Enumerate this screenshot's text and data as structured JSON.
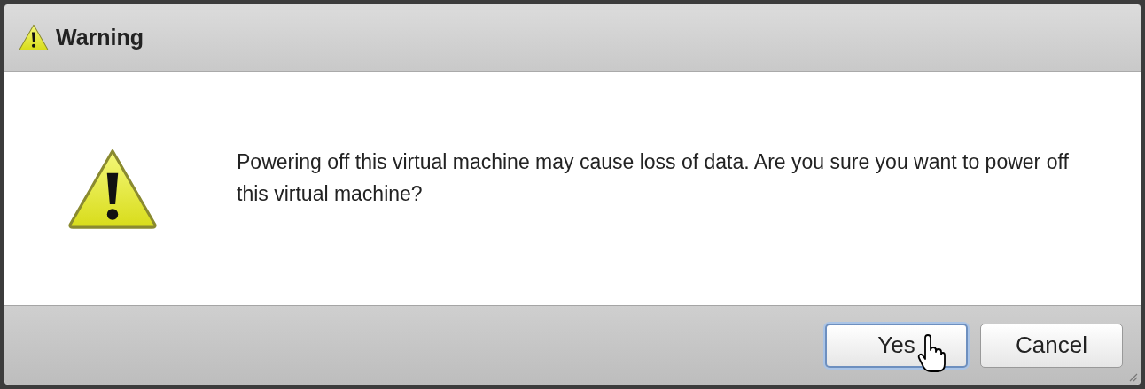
{
  "window": {
    "title": "Warning"
  },
  "message": "Powering off this virtual machine may cause loss of data. Are you sure you want to power off this virtual machine?",
  "buttons": [
    {
      "label": "Yes",
      "focused": true
    },
    {
      "label": "Cancel",
      "focused": false
    }
  ]
}
